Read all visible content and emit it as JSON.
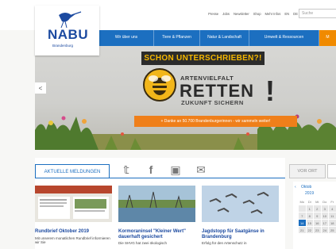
{
  "topbar": {
    "links": [
      "Presse",
      "Jobs",
      "Newsletter",
      "Shop",
      "Mehr Infos",
      "EN",
      "DE"
    ],
    "search_placeholder": "Suche"
  },
  "logo": {
    "text": "NABU",
    "subtitle": "Brandenburg"
  },
  "nav": {
    "items": [
      {
        "label": "Wir über uns"
      },
      {
        "label": "Tiere & Pflanzen"
      },
      {
        "label": "Natur & Landschaft"
      },
      {
        "label": "Umwelt & Ressourcen"
      },
      {
        "label": "M"
      }
    ]
  },
  "hero": {
    "banner": "SCHON UNTERSCHRIEBEN?!",
    "slogan_line1": "ARTENVIELFALT",
    "slogan_line2": "RETTEN",
    "slogan_line3": "ZUKUNFT SICHERN",
    "exclamation": "!",
    "cta": "+ Danke an 50.700 Brandenburgerinnen - wir sammeln weiter!",
    "prev_arrow": "<"
  },
  "news": {
    "tab_label": "AKTUELLE MELDUNGEN",
    "social_icons": [
      "twitter-icon",
      "facebook-icon",
      "youtube-icon",
      "newsletter-icon"
    ],
    "social_glyphs": [
      "𝕥",
      "f",
      "▣",
      "✉"
    ],
    "cards": [
      {
        "title": "Rundbrief Oktober 2019",
        "text": "Mit unserem monatlichen Rundbrief informieren wir Sie"
      },
      {
        "title": "Kormoraninsel \"Kleiner Wert\" dauerhaft gesichert",
        "text": "Die SHVG hat zwei ökologisch"
      },
      {
        "title": "Jagdstopp für Saatgänse in Brandenburg",
        "text": "Erfolg für den Artenschutz in"
      }
    ]
  },
  "sidebar": {
    "tab_label": "VOR ORT",
    "calendar_month": "Oktob",
    "calendar_year": "2019",
    "calendar_prev": "‹",
    "calendar_days": [
      "Mo",
      "Di",
      "Mi",
      "Do",
      "Fr"
    ],
    "calendar_dates": [
      "1",
      "2",
      "3",
      "4",
      "7",
      "8",
      "9",
      "10",
      "11",
      "14",
      "15",
      "16",
      "17",
      "18",
      "21",
      "22",
      "23",
      "24",
      "25"
    ],
    "today": "14"
  },
  "colors": {
    "nabu_blue": "#1c6fc0",
    "orange": "#ef7f1a",
    "banner_yellow": "#f5b700"
  }
}
